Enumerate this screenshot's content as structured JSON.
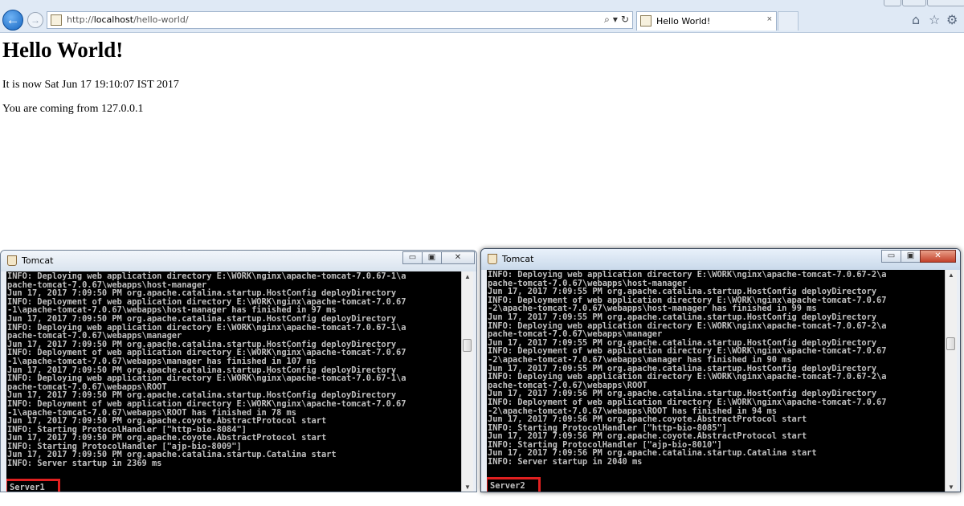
{
  "browser": {
    "url_prefix": "http://",
    "url_host": "localhost",
    "url_path": "/hello-world/",
    "tab_title": "Hello World!",
    "tab_close": "×",
    "addr_search_icon": "⌕",
    "addr_dropdown_icon": "▾",
    "addr_refresh_icon": "↻",
    "back_icon": "←",
    "forward_icon": "→",
    "home_icon": "⌂",
    "favorites_icon": "☆",
    "tools_icon": "⚙"
  },
  "page": {
    "title": "Hello World!",
    "line1": "It is now Sat Jun 17 19:10:07 IST 2017",
    "line2": "You are coming from 127.0.0.1"
  },
  "windows": [
    {
      "title": "Tomcat",
      "min_label": "▭",
      "max_label": "▣",
      "close_label": "✕",
      "log": "INFO: Deploying web application directory E:\\WORK\\nginx\\apache-tomcat-7.0.67-1\\a\npache-tomcat-7.0.67\\webapps\\host-manager\nJun 17, 2017 7:09:50 PM org.apache.catalina.startup.HostConfig deployDirectory\nINFO: Deployment of web application directory E:\\WORK\\nginx\\apache-tomcat-7.0.67\n-1\\apache-tomcat-7.0.67\\webapps\\host-manager has finished in 97 ms\nJun 17, 2017 7:09:50 PM org.apache.catalina.startup.HostConfig deployDirectory\nINFO: Deploying web application directory E:\\WORK\\nginx\\apache-tomcat-7.0.67-1\\a\npache-tomcat-7.0.67\\webapps\\manager\nJun 17, 2017 7:09:50 PM org.apache.catalina.startup.HostConfig deployDirectory\nINFO: Deployment of web application directory E:\\WORK\\nginx\\apache-tomcat-7.0.67\n-1\\apache-tomcat-7.0.67\\webapps\\manager has finished in 107 ms\nJun 17, 2017 7:09:50 PM org.apache.catalina.startup.HostConfig deployDirectory\nINFO: Deploying web application directory E:\\WORK\\nginx\\apache-tomcat-7.0.67-1\\a\npache-tomcat-7.0.67\\webapps\\ROOT\nJun 17, 2017 7:09:50 PM org.apache.catalina.startup.HostConfig deployDirectory\nINFO: Deployment of web application directory E:\\WORK\\nginx\\apache-tomcat-7.0.67\n-1\\apache-tomcat-7.0.67\\webapps\\ROOT has finished in 78 ms\nJun 17, 2017 7:09:50 PM org.apache.coyote.AbstractProtocol start\nINFO: Starting ProtocolHandler [\"http-bio-8084\"]\nJun 17, 2017 7:09:50 PM org.apache.coyote.AbstractProtocol start\nINFO: Starting ProtocolHandler [\"ajp-bio-8009\"]\nJun 17, 2017 7:09:50 PM org.apache.catalina.startup.Catalina start\nINFO: Server startup in 2369 ms",
      "server_label": "Server1"
    },
    {
      "title": "Tomcat",
      "min_label": "▭",
      "max_label": "▣",
      "close_label": "✕",
      "log": "INFO: Deploying web application directory E:\\WORK\\nginx\\apache-tomcat-7.0.67-2\\a\npache-tomcat-7.0.67\\webapps\\host-manager\nJun 17, 2017 7:09:55 PM org.apache.catalina.startup.HostConfig deployDirectory\nINFO: Deployment of web application directory E:\\WORK\\nginx\\apache-tomcat-7.0.67\n-2\\apache-tomcat-7.0.67\\webapps\\host-manager has finished in 99 ms\nJun 17, 2017 7:09:55 PM org.apache.catalina.startup.HostConfig deployDirectory\nINFO: Deploying web application directory E:\\WORK\\nginx\\apache-tomcat-7.0.67-2\\a\npache-tomcat-7.0.67\\webapps\\manager\nJun 17, 2017 7:09:55 PM org.apache.catalina.startup.HostConfig deployDirectory\nINFO: Deployment of web application directory E:\\WORK\\nginx\\apache-tomcat-7.0.67\n-2\\apache-tomcat-7.0.67\\webapps\\manager has finished in 90 ms\nJun 17, 2017 7:09:55 PM org.apache.catalina.startup.HostConfig deployDirectory\nINFO: Deploying web application directory E:\\WORK\\nginx\\apache-tomcat-7.0.67-2\\a\npache-tomcat-7.0.67\\webapps\\ROOT\nJun 17, 2017 7:09:56 PM org.apache.catalina.startup.HostConfig deployDirectory\nINFO: Deployment of web application directory E:\\WORK\\nginx\\apache-tomcat-7.0.67\n-2\\apache-tomcat-7.0.67\\webapps\\ROOT has finished in 94 ms\nJun 17, 2017 7:09:56 PM org.apache.coyote.AbstractProtocol start\nINFO: Starting ProtocolHandler [\"http-bio-8085\"]\nJun 17, 2017 7:09:56 PM org.apache.coyote.AbstractProtocol start\nINFO: Starting ProtocolHandler [\"ajp-bio-8010\"]\nJun 17, 2017 7:09:56 PM org.apache.catalina.startup.Catalina start\nINFO: Server startup in 2040 ms",
      "server_label": "Server2"
    }
  ]
}
